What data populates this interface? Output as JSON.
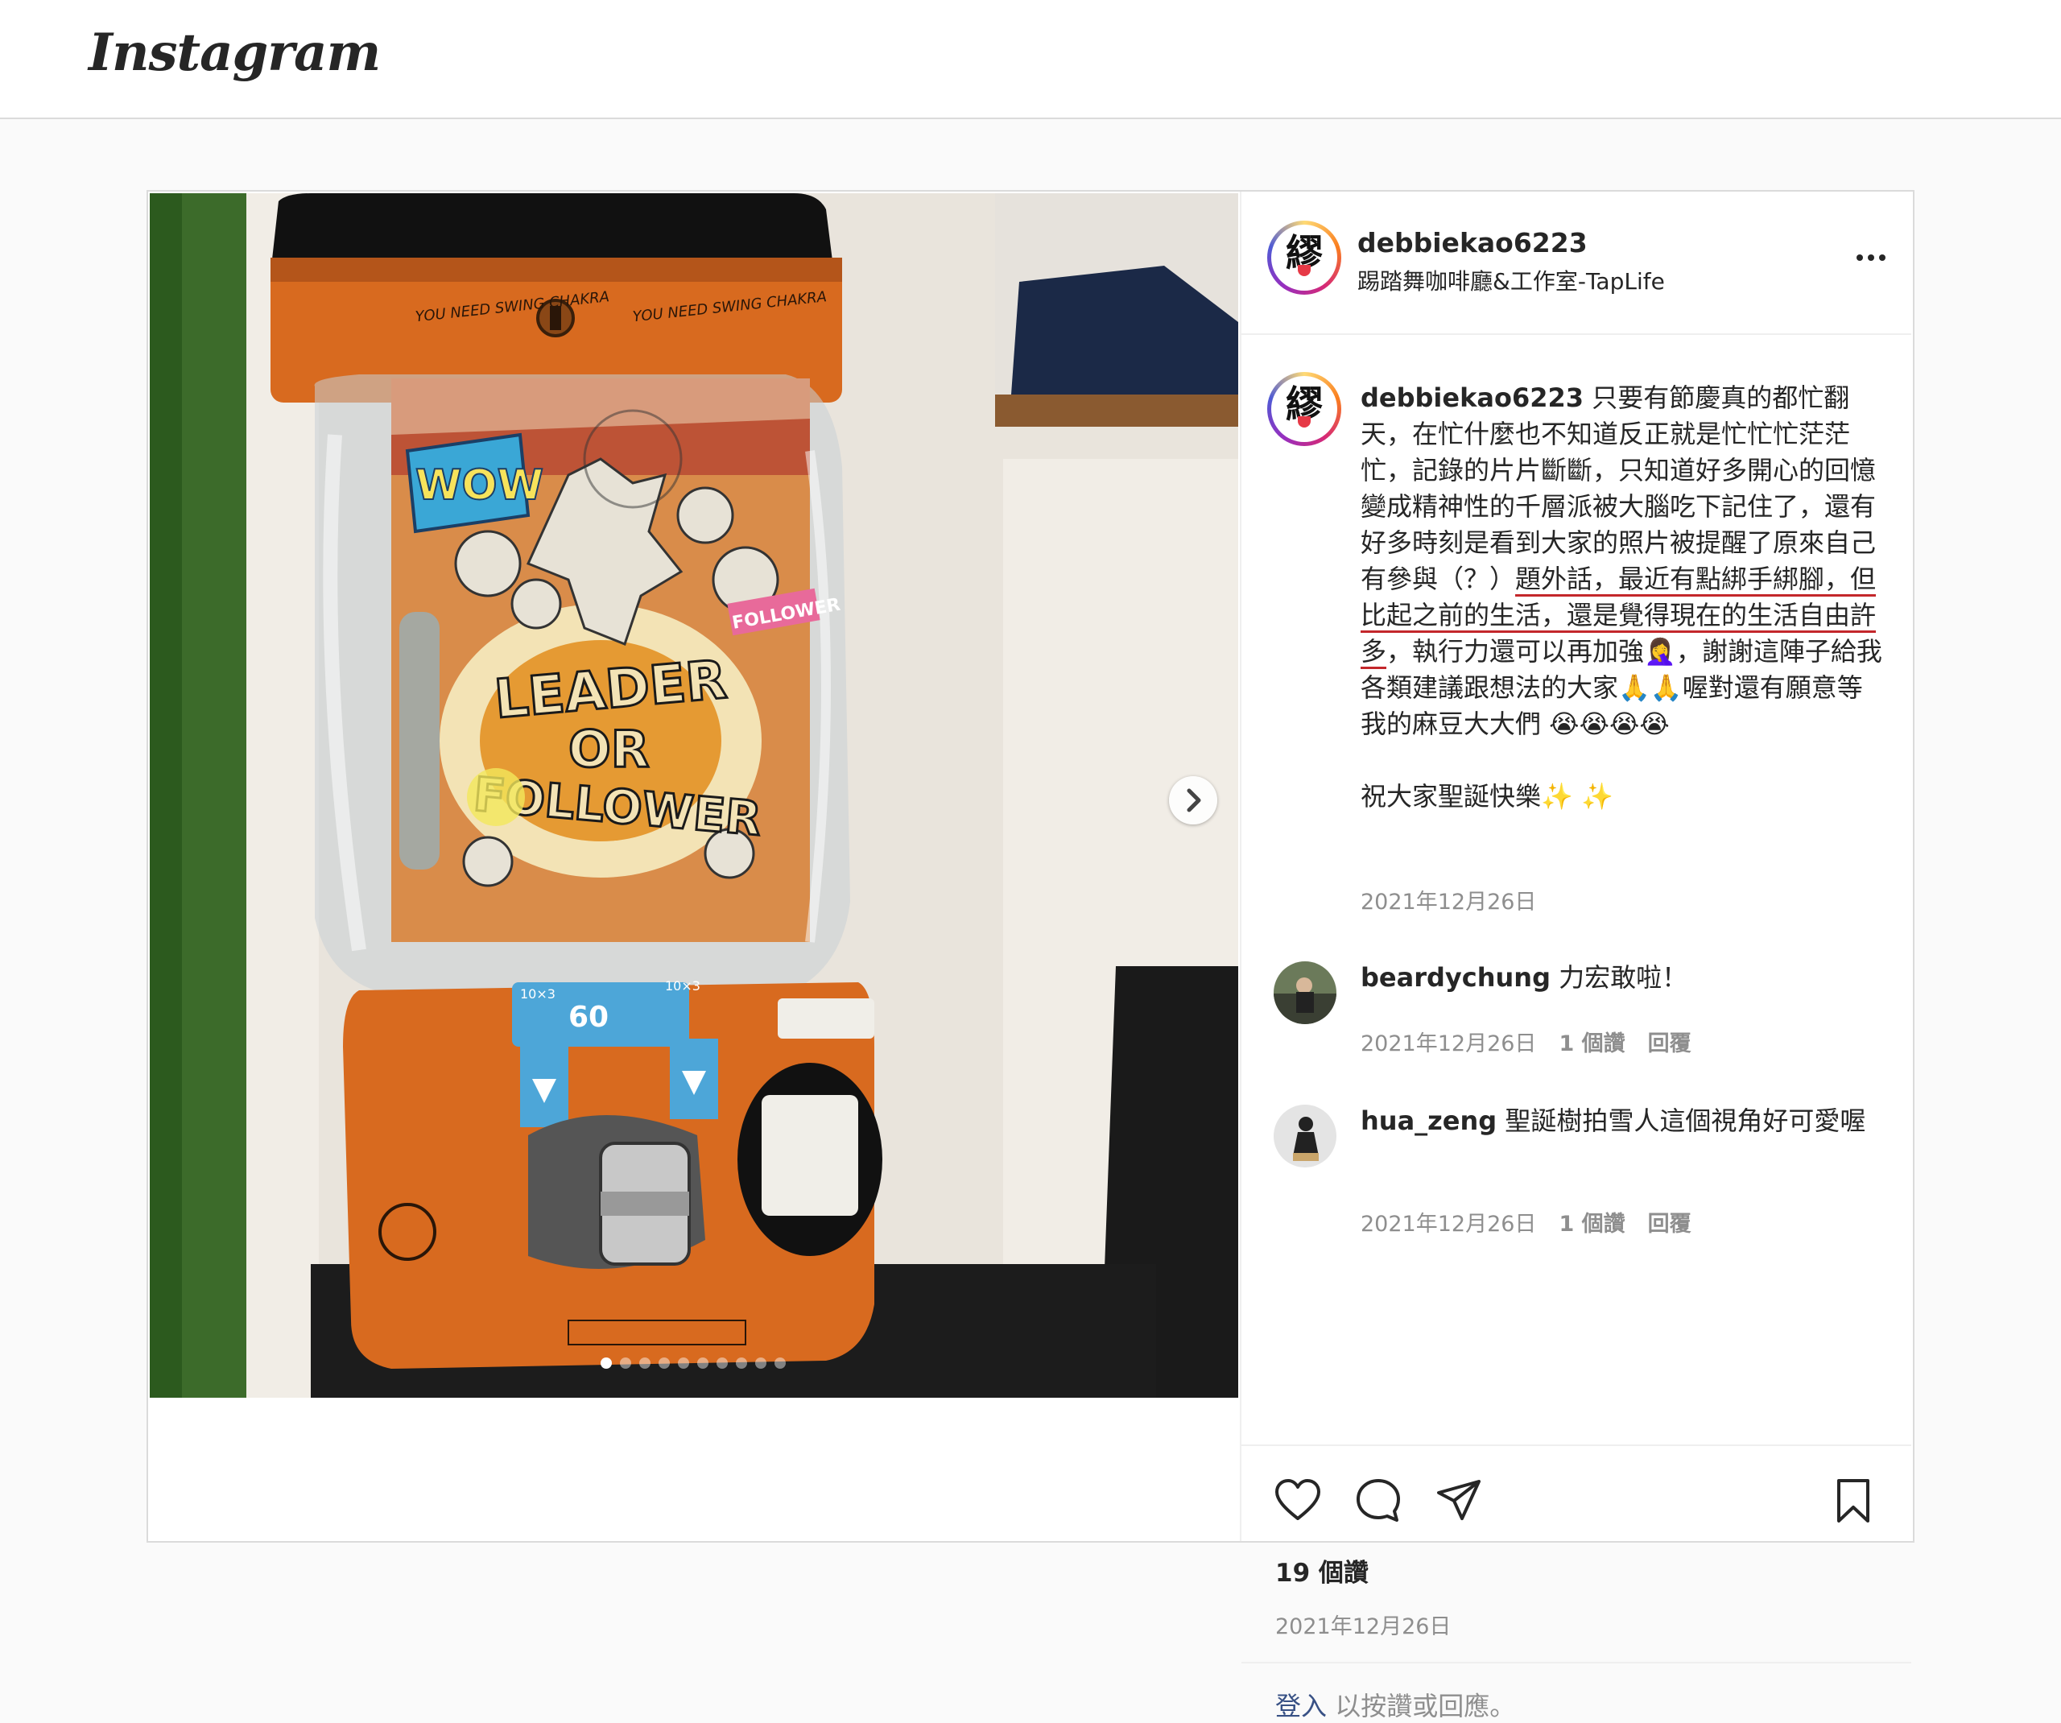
{
  "header": {
    "logo": "Instagram"
  },
  "media": {
    "carousel_count": 10,
    "active_index": 0,
    "machine_text": {
      "headline_1": "LEADER",
      "headline_2": "OR",
      "headline_3": "FOLLOWER",
      "sticker_wow": "WOW",
      "sticker_follower": "FOLLOWER",
      "swing_left": "YOU NEED SWING CHAKRA",
      "swing_right": "YOU NEED SWING CHAKRA",
      "price": "60",
      "coin_left": "10×3",
      "coin_right": "10×3"
    }
  },
  "post": {
    "username": "debbiekao6223",
    "location": "踢踏舞咖啡廳&工作室-TapLife",
    "caption_parts": {
      "before": " 只要有節慶真的都忙翻天，在忙什麼也不知道反正就是忙忙忙茫茫忙，記錄的片片斷斷，只知道好多開心的回憶變成精神性的千層派被大腦吃下記住了，還有好多時刻是看到大家的照片被提醒了原來自己有參與（？）",
      "highlight": "題外話，最近有點綁手綁腳，但比起之前的生活，還是覺得現在的生活自由許多",
      "after": "，執行力還可以再加強🤦‍♀️，謝謝這陣子給我各類建議跟想法的大家🙏🙏喔對還有願意等我的麻豆大大們 😭😭😭😭",
      "second_para": "祝大家聖誕快樂✨ ✨"
    },
    "caption_date": "2021年12月26日",
    "likes": "19 個讚",
    "date": "2021年12月26日"
  },
  "comments": [
    {
      "username": "beardychung",
      "text": " 力宏敢啦！",
      "date": "2021年12月26日",
      "likes": "1 個讚",
      "reply": "回覆"
    },
    {
      "username": "hua_zeng",
      "text": " 聖誕樹拍雪人這個視角好可愛喔",
      "date": "2021年12月26日",
      "likes": "1 個讚",
      "reply": "回覆"
    }
  ],
  "footer": {
    "login_link": "登入",
    "login_rest": " 以按讚或回應。"
  },
  "colors": {
    "accent_underline": "#c3272b",
    "machine_orange": "#d86a1f",
    "muted_text": "#8e8e8e"
  },
  "icons": [
    "more-icon",
    "heart-icon",
    "comment-icon",
    "share-icon",
    "bookmark-icon",
    "chevron-right-icon"
  ]
}
